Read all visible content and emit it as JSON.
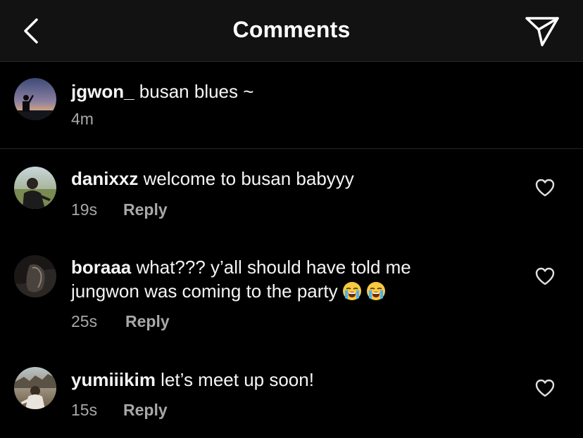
{
  "header": {
    "title": "Comments",
    "back_icon": "chevron-left-icon",
    "send_icon": "paper-plane-icon"
  },
  "caption": {
    "username": "jgwon_",
    "text": "busan blues ~",
    "time": "4m"
  },
  "comments": [
    {
      "username": "danixxz",
      "text": "welcome to busan babyyy",
      "time": "19s",
      "reply_label": "Reply"
    },
    {
      "username": "boraaa",
      "text_line1": "what??? y’all should have told me",
      "text_line2": "jungwon was coming to the party",
      "emoji": [
        "loudly-crying-face",
        "loudly-crying-face"
      ],
      "time": "25s",
      "reply_label": "Reply"
    },
    {
      "username": "yumiiikim",
      "text": "let’s meet up soon!",
      "time": "15s",
      "reply_label": "Reply"
    }
  ],
  "colors": {
    "background": "#000000",
    "header": "#121212",
    "primary_text": "#f5f5f5",
    "secondary_text": "#a8a8a8",
    "divider": "#262626"
  }
}
